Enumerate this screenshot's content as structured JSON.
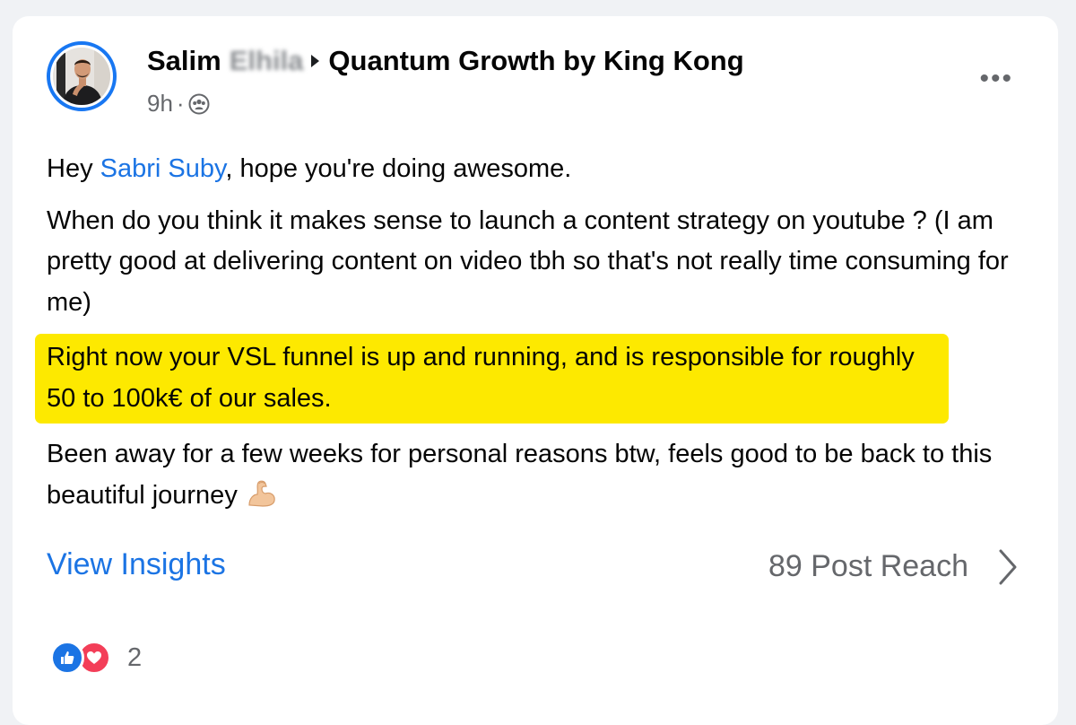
{
  "post": {
    "author_name": "Salim",
    "author_surname_blurred": "Elhila",
    "group_name": "Quantum Growth by King Kong",
    "time": "9h",
    "time_separator": "·",
    "audience_icon": "group-audience-icon",
    "more_label": "•••",
    "greeting_prefix": "Hey ",
    "mention": "Sabri Suby",
    "greeting_suffix": ", hope you're doing awesome.",
    "paragraph_2": "When do you think it makes sense to launch a content strategy on youtube ? (I am pretty good at delivering content on video tbh so that's not really time consuming for me)",
    "paragraph_highlight": "Right now your VSL funnel is up and running, and is responsible for roughly 50 to 100k€ of our sales.",
    "paragraph_4": "Been away for a few weeks for personal reasons btw, feels good to be back to this beautiful journey",
    "emoji": "flexed-biceps-emoji"
  },
  "footer": {
    "insights_label": "View Insights",
    "reach_label": "89 Post Reach"
  },
  "reactions": {
    "types": [
      "like",
      "love"
    ],
    "count": "2"
  },
  "colors": {
    "accent": "#1b74e4",
    "highlight": "#fde900",
    "love": "#f33e58",
    "muted": "#65676b"
  }
}
